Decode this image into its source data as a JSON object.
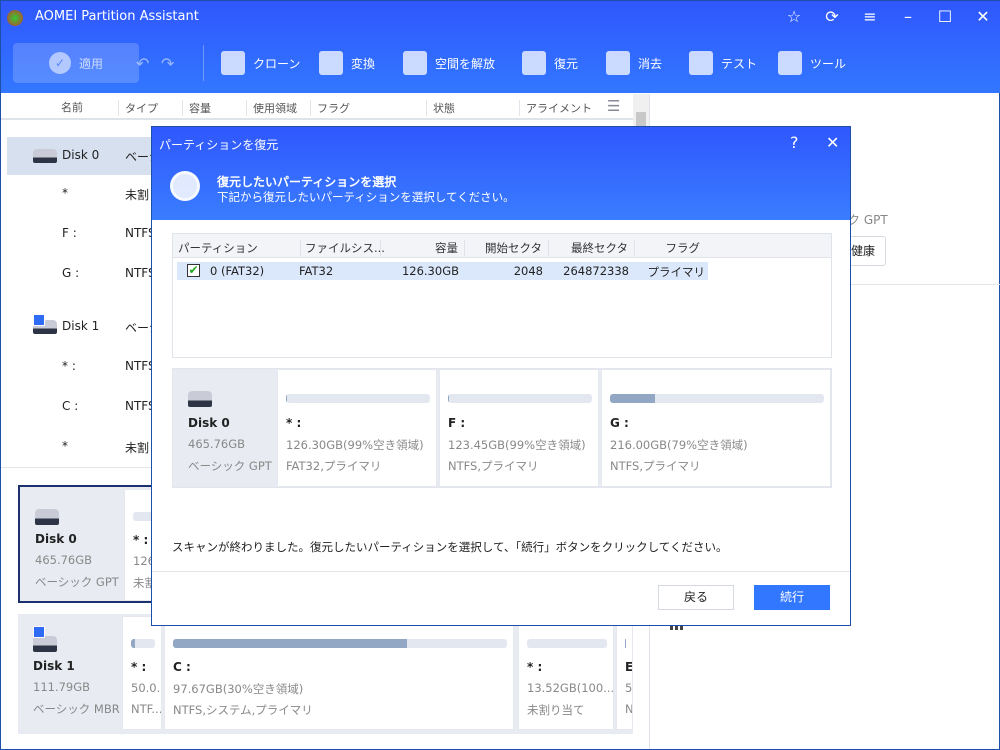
{
  "app": {
    "title": "AOMEI Partition Assistant"
  },
  "toolbar": {
    "apply": "適用",
    "items": [
      "クローン",
      "変換",
      "空間を解放",
      "復元",
      "消去",
      "テスト",
      "ツール"
    ]
  },
  "columns": [
    "名前",
    "タイプ",
    "容量",
    "使用領域",
    "フラグ",
    "状態",
    "アライメント"
  ],
  "tree": [
    {
      "name": "Disk 0",
      "type": "ベーシ",
      "disk": true
    },
    {
      "name": "*",
      "type": "未割り"
    },
    {
      "name": "F :",
      "type": "NTFS"
    },
    {
      "name": "G :",
      "type": "NTFS"
    },
    {
      "name": "Disk 1",
      "type": "ベーシ",
      "disk": true
    },
    {
      "name": "* :",
      "type": "NTFS"
    },
    {
      "name": "C :",
      "type": "NTFS"
    },
    {
      "name": "*",
      "type": "未割り"
    }
  ],
  "right": {
    "type_partial": "ク GPT",
    "health": "健康"
  },
  "disks": [
    {
      "name": "Disk 0",
      "size": "465.76GB",
      "type": "ベーシック GPT",
      "parts": [
        {
          "label": "* :",
          "size": "126.",
          "fs": "未割",
          "used": 0
        }
      ]
    },
    {
      "name": "Disk 1",
      "size": "111.79GB",
      "type": "ベーシック MBR",
      "parts": [
        {
          "label": "* :",
          "size": "50.0...",
          "fs": "NTF...",
          "used": 15
        },
        {
          "label": "C :",
          "size": "97.67GB(30%空き領域)",
          "fs": "NTFS,システム,プライマリ",
          "used": 70
        },
        {
          "label": "* :",
          "size": "13.52GB(100...",
          "fs": "未割り当て",
          "used": 0
        },
        {
          "label": "E :",
          "size": "5...",
          "fs": "N...",
          "used": 40
        }
      ]
    }
  ],
  "dialog": {
    "title": "パーティションを復元",
    "heading": "復元したいパーティションを選択",
    "subheading": "下記から復元したいパーティションを選択してください。",
    "table": {
      "headers": [
        "パーティション",
        "ファイルシス...",
        "容量",
        "開始セクタ",
        "最終セクタ",
        "フラグ"
      ],
      "rows": [
        {
          "checked": true,
          "partition": "0 (FAT32)",
          "fs": "FAT32",
          "capacity": "126.30GB",
          "start": "2048",
          "end": "264872338",
          "flag": "プライマリ"
        }
      ]
    },
    "disk": {
      "name": "Disk 0",
      "size": "465.76GB",
      "type": "ベーシック GPT",
      "parts": [
        {
          "label": "* :",
          "size": "126.30GB(99%空き領域)",
          "fs": "FAT32,プライマリ",
          "used": 1
        },
        {
          "label": "F :",
          "size": "123.45GB(99%空き領域)",
          "fs": "NTFS,プライマリ",
          "used": 1
        },
        {
          "label": "G :",
          "size": "216.00GB(79%空き領域)",
          "fs": "NTFS,プライマリ",
          "used": 21
        }
      ]
    },
    "message": "スキャンが終わりました。復元したいパーティションを選択して、「続行」ボタンをクリックしてください。",
    "back": "戻る",
    "next": "続行"
  },
  "colors": {
    "accent": "#2f57fd",
    "button": "#3277ff",
    "bar_used": "#91a7c4"
  }
}
